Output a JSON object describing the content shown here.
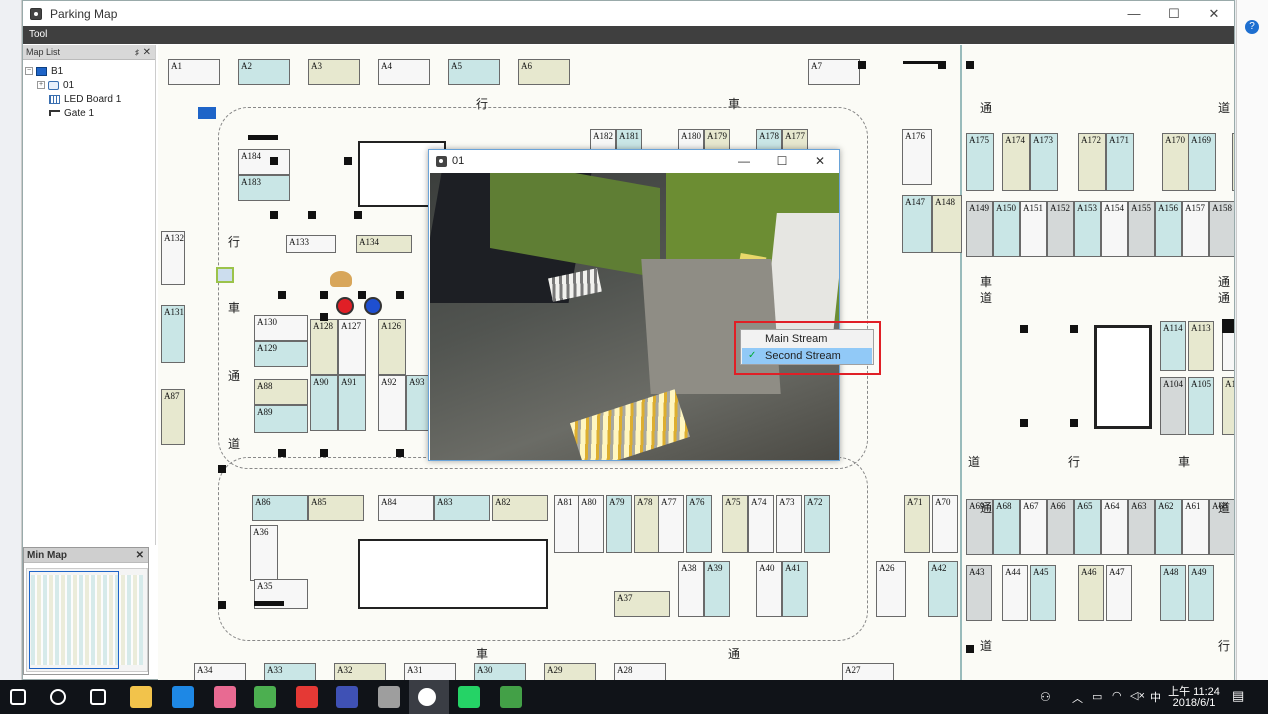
{
  "window": {
    "title": "Parking Map",
    "minimize": "—",
    "maximize": "☐",
    "close": "✕"
  },
  "toolbar": {
    "tool_label": "Tool"
  },
  "map_list": {
    "title": "Map List",
    "pin": "♯",
    "close": "✕",
    "nodes": [
      {
        "label": "B1",
        "icon": "map-icon"
      },
      {
        "label": "01",
        "icon": "camera-icon"
      },
      {
        "label": "LED Board 1",
        "icon": "led-board-icon"
      },
      {
        "label": "Gate 1",
        "icon": "gate-icon"
      }
    ]
  },
  "min_map": {
    "title": "Min Map",
    "close": "✕"
  },
  "video_window": {
    "title": "01",
    "minimize": "—",
    "maximize": "☐",
    "close": "✕"
  },
  "context_menu": {
    "items": [
      {
        "label": "Main Stream",
        "checked": false
      },
      {
        "label": "Second Stream",
        "checked": true
      }
    ],
    "check_mark": "✓"
  },
  "map": {
    "road_labels": [
      "行",
      "車",
      "通",
      "道",
      "行",
      "車",
      "通",
      "道",
      "行",
      "車",
      "通",
      "道",
      "通",
      "道",
      "行",
      "車",
      "通",
      "道",
      "行",
      "車",
      "通",
      "道"
    ],
    "slots_top": [
      "A1",
      "A2",
      "A3",
      "A4",
      "A5",
      "A6",
      "A7"
    ],
    "slots_left": [
      "A184",
      "A183",
      "A132",
      "A133",
      "A134",
      "A131",
      "A130",
      "A129",
      "A88",
      "A89",
      "A87",
      "A128",
      "A127",
      "A126",
      "A90",
      "A91",
      "A92",
      "A93"
    ],
    "slots_upper_mid": [
      "A182",
      "A181",
      "A180",
      "A179",
      "A178",
      "A177",
      "A176",
      "A147",
      "A148"
    ],
    "slots_right_top": [
      "A175",
      "A174",
      "A173",
      "A172",
      "A171",
      "A170",
      "A169",
      "A16"
    ],
    "slots_right_row2": [
      "A149",
      "A150",
      "A151",
      "A152",
      "A153",
      "A154",
      "A155",
      "A156",
      "A157",
      "A158",
      "A15"
    ],
    "slots_right_mid": [
      "A114",
      "A113",
      "A11",
      "A104",
      "A105",
      "A10"
    ],
    "slots_lower_row": [
      "A86",
      "A85",
      "A84",
      "A83",
      "A82",
      "A81",
      "A80",
      "A79",
      "A78",
      "A77",
      "A76",
      "A75",
      "A74",
      "A73",
      "A72",
      "A71",
      "A70"
    ],
    "slots_lower_right": [
      "A69",
      "A68",
      "A67",
      "A66",
      "A65",
      "A64",
      "A63",
      "A62",
      "A61",
      "A60",
      "A59"
    ],
    "slots_bottom_left": [
      "A36",
      "A35",
      "A37",
      "A38",
      "A39",
      "A40",
      "A41",
      "A26",
      "A42",
      "A43",
      "A44",
      "A45",
      "A46",
      "A47",
      "A48",
      "A49",
      "A50"
    ],
    "slots_bottom": [
      "A34",
      "A33",
      "A32",
      "A31",
      "A30",
      "A29",
      "A28",
      "A27"
    ]
  },
  "taskbar": {
    "time": "上午 11:24",
    "date": "2018/6/1",
    "ime": "中",
    "apps": [
      "start-icon",
      "search-icon",
      "task-view-icon",
      "file-explorer-icon",
      "store-icon",
      "paint-icon",
      "chrome-icon",
      "app-g-icon",
      "app-info-icon",
      "app-brush-icon",
      "parking-app-icon",
      "whatsapp-icon",
      "app-s-icon"
    ]
  }
}
